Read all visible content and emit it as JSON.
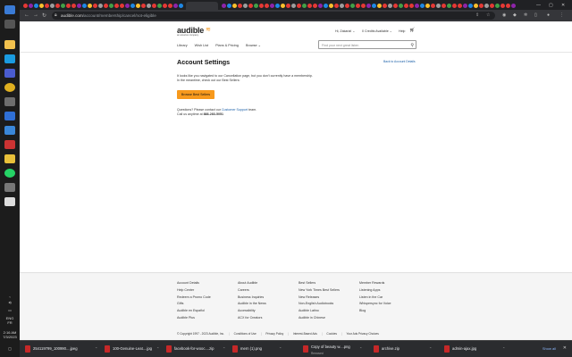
{
  "taskbar": {
    "time": "2:16 AM",
    "date": "7/3/2023",
    "lang": "ENG",
    "region": "FR"
  },
  "browser": {
    "url_host": "audible.com",
    "url_path": "/account/membership/cancel/not-eligible"
  },
  "header": {
    "logo_text": "audible",
    "logo_sub": "an amazon company",
    "greeting": "Hi, Zakaria! ⌄",
    "credits": "0 Credits Available ⌄",
    "help": "Help",
    "nav": [
      "Library",
      "Wish List",
      "Plans & Pricing",
      "Browse ⌄"
    ],
    "search_placeholder": "Find your next great listen"
  },
  "main": {
    "title": "Account Settings",
    "back_link": "Back to Account Details",
    "message_line1": "It looks like you navigated to our Cancellation page, but you don't currently have a membership.",
    "message_line2": "In the meantime, check out our Best Sellers:",
    "button": "Browse Best Sellers",
    "questions_prefix": "Questions? Please contact our ",
    "questions_link": "Customer Support",
    "questions_suffix": " team.",
    "call_prefix": "Call us anytime at ",
    "phone": "888-283-5051"
  },
  "footer": {
    "columns": [
      [
        "Account Details",
        "Help Center",
        "Redeem a Promo Code",
        "Gifts",
        "Audible en Español",
        "Audible Plus"
      ],
      [
        "About Audible",
        "Careers",
        "Business Inquiries",
        "Audible in the News",
        "Accessibility",
        "ACX for Creators"
      ],
      [
        "Best Sellers",
        "New York Times Best Sellers",
        "New Releases",
        "Non-English Audiobooks",
        "Audible Latino",
        "Audible in Chinese"
      ],
      [
        "Member Rewards",
        "Listening Apps",
        "Listen in the Car",
        "Whispersync for Voice",
        "Blog"
      ]
    ],
    "copyright": "© Copyright 1997 - 2023 Audible, Inc.",
    "links": [
      "Conditions of Use",
      "Privacy Policy",
      "Interest-Based Ads",
      "Cookies",
      "Your Ads Privacy Choices"
    ]
  },
  "downloads": {
    "items": [
      {
        "name": "254119799_100990....jpeg",
        "status": ""
      },
      {
        "name": "100-Genuine-Leat....jpg",
        "status": ""
      },
      {
        "name": "facebook-for-wooc....zip",
        "status": ""
      },
      {
        "name": "mern (1).png",
        "status": ""
      },
      {
        "name": "Copy of beauty w....png",
        "status": "Removed"
      },
      {
        "name": "archive.zip",
        "status": ""
      },
      {
        "name": "admin-ajax.jpg",
        "status": ""
      }
    ],
    "show_all": "Show all"
  },
  "colors": {
    "accent": "#f7991c",
    "link": "#1a5fa8"
  }
}
